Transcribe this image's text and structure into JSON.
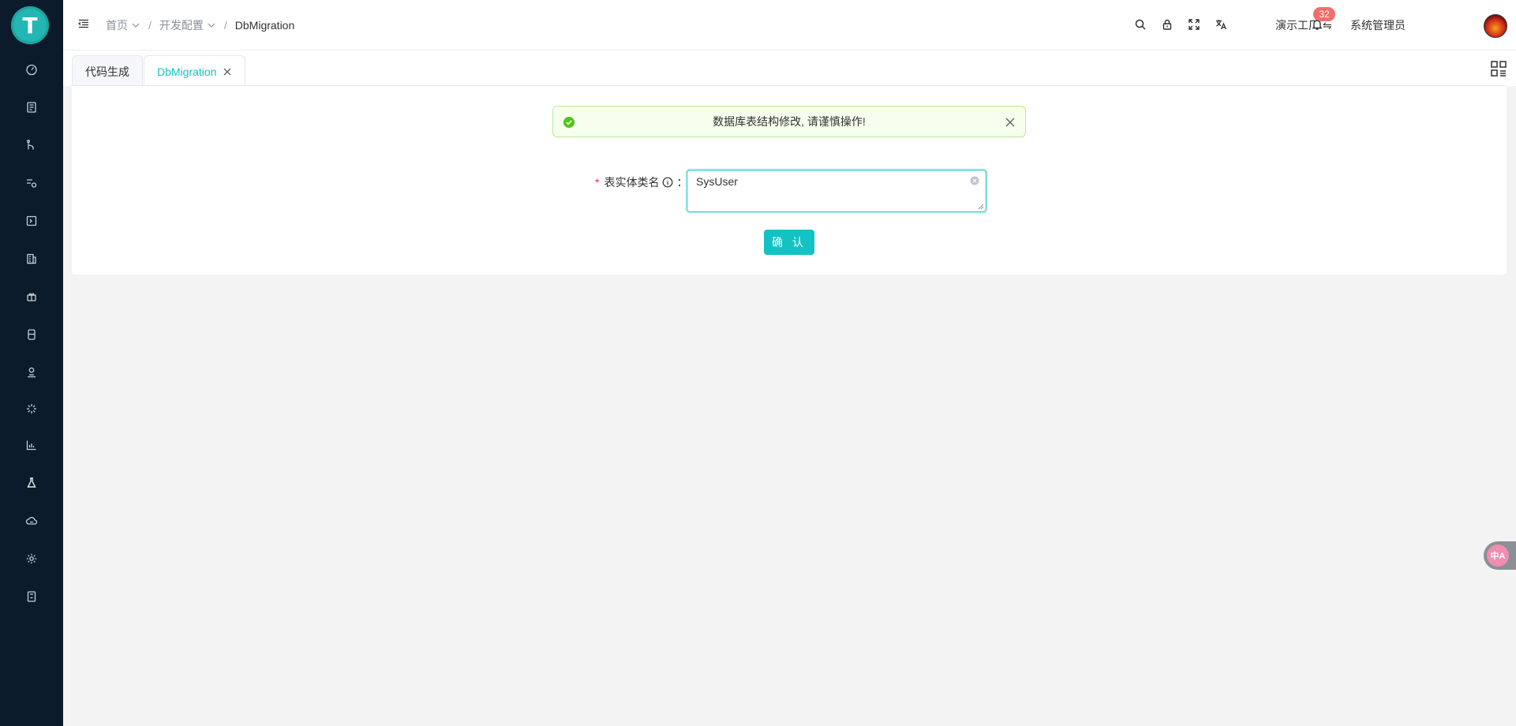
{
  "app": {
    "logo_letter": "T"
  },
  "sidebar": {
    "items": [
      {
        "icon": "dashboard-icon"
      },
      {
        "icon": "document-icon"
      },
      {
        "icon": "workflow-icon"
      },
      {
        "icon": "settings-flow-icon"
      },
      {
        "icon": "terminal-icon"
      },
      {
        "icon": "building-icon"
      },
      {
        "icon": "package-icon"
      },
      {
        "icon": "database-icon"
      },
      {
        "icon": "user-stamp-icon"
      },
      {
        "icon": "loading-icon"
      },
      {
        "icon": "bar-chart-icon"
      },
      {
        "icon": "flask-icon"
      },
      {
        "icon": "cloud-icon"
      },
      {
        "icon": "gear-icon"
      },
      {
        "icon": "calculator-icon"
      }
    ]
  },
  "header": {
    "breadcrumb": [
      {
        "label": "首页",
        "dropdown": true
      },
      {
        "label": "开发配置",
        "dropdown": true
      },
      {
        "label": "DbMigration",
        "dropdown": false
      }
    ],
    "separator": "/",
    "notification_count": "32",
    "tenant_label": "演示工厂",
    "tenant_switch_icon": "⇋",
    "user_name": "系统管理员"
  },
  "tabs": [
    {
      "label": "代码生成",
      "active": false,
      "closable": false
    },
    {
      "label": "DbMigration",
      "active": true,
      "closable": true
    }
  ],
  "content": {
    "alert": {
      "type": "success",
      "text": "数据库表结构修改, 请谨慎操作!"
    },
    "form": {
      "required_mark": "*",
      "label": "表实体类名",
      "colon": "：",
      "value": "SysUser"
    },
    "confirm_label": "确 认"
  },
  "float_widget": {
    "label": "中A"
  },
  "colors": {
    "accent": "#13c2c2",
    "sidebar_bg": "#0b1b2b",
    "success_bg": "#f6ffed",
    "success_border": "#b7eb8f",
    "badge": "#f56c6c"
  }
}
